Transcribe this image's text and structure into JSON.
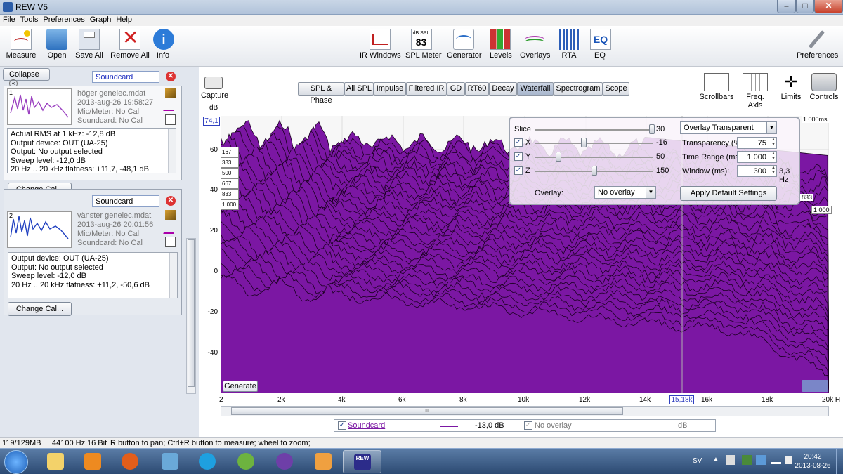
{
  "window": {
    "title": "REW V5"
  },
  "menu": [
    "File",
    "Tools",
    "Preferences",
    "Graph",
    "Help"
  ],
  "toolbar": {
    "left": [
      "Measure",
      "Open",
      "Save All",
      "Remove All",
      "Info"
    ],
    "center": [
      "IR Windows",
      "SPL Meter",
      "Generator",
      "Levels",
      "Overlays",
      "RTA",
      "EQ"
    ],
    "spl_meter_text": "dB SPL",
    "spl_meter_value": "83",
    "eq_text": "EQ",
    "right": "Preferences"
  },
  "left_panel": {
    "collapse_label": "Collapse",
    "measurements": [
      {
        "index": "1",
        "name": "Soundcard",
        "file": "höger genelec.mdat",
        "date": "2013-aug-26 19:58:27",
        "mic": "Mic/Meter: No Cal",
        "soundcard": "Soundcard: No Cal",
        "info": [
          "Actual RMS at 1 kHz: -12,8 dB",
          "Output device: OUT (UA-25)",
          "Output: No output selected",
          "Sweep level: -12,0 dB",
          "20 Hz .. 20 kHz flatness: +11,7, -48,1 dB"
        ],
        "change_cal": "Change Cal...",
        "color": "#9a3fc0"
      },
      {
        "index": "2",
        "name": "Soundcard",
        "file": "vänster genelec.mdat",
        "date": "2013-aug-26 20:01:56",
        "mic": "Mic/Meter: No Cal",
        "soundcard": "Soundcard: No Cal",
        "info": [
          "Output device: OUT (UA-25)",
          "Output: No output selected",
          "Sweep level: -12,0 dB",
          "20 Hz .. 20 kHz flatness: +11,2, -50,6 dB"
        ],
        "change_cal": "Change Cal...",
        "color": "#2040c0"
      }
    ]
  },
  "graph": {
    "capture_label": "Capture",
    "tabs": [
      "SPL & Phase",
      "All SPL",
      "Impulse",
      "Filtered IR",
      "GD",
      "RT60",
      "Decay",
      "Waterfall",
      "Spectrogram",
      "Scope"
    ],
    "active_tab": "Waterfall",
    "right_tools": [
      "Scrollbars",
      "Freq. Axis",
      "Limits",
      "Controls"
    ],
    "y_unit": "dB",
    "y_cursor": "74,1",
    "y_ticks": [
      "60",
      "40",
      "20",
      "0",
      "-20",
      "-40"
    ],
    "x_ticks": [
      "2",
      "2k",
      "4k",
      "6k",
      "8k",
      "10k",
      "12k",
      "14k",
      "16k",
      "18k",
      "20k H"
    ],
    "x_cursor": "15,18k",
    "time_labels": [
      "167",
      "333",
      "500",
      "667",
      "833",
      "1 000"
    ],
    "time_right_labels": [
      "1 000ms",
      "667",
      "833",
      "1 000"
    ],
    "generate_label": "Generate",
    "fill_color": "#7b17a3",
    "scroll_mark": "III"
  },
  "overlay_panel": {
    "slice_label": "Slice",
    "slice_value": "30",
    "x_label": "X",
    "x_value": "-16",
    "y_label": "Y",
    "y_value": "50",
    "z_label": "Z",
    "z_value": "150",
    "overlay_label": "Overlay:",
    "overlay_select": "No overlay",
    "mode_select": "Overlay Transparent",
    "transparency_label": "Transparency (%)",
    "transparency_value": "75",
    "time_range_label": "Time Range (ms):",
    "time_range_value": "1 000",
    "window_label": "Window (ms):",
    "window_value": "300",
    "window_hz": "3,3 Hz",
    "apply_label": "Apply Default Settings"
  },
  "legend": {
    "series_name": "Soundcard",
    "series_value": "-13,0 dB",
    "overlay_name": "No overlay",
    "overlay_unit": "dB"
  },
  "status": {
    "memory": "119/129MB",
    "rate": "44100 Hz",
    "bits": "16 Bit",
    "hint": "R button to pan; Ctrl+R button to measure; wheel to zoom;"
  },
  "taskbar": {
    "lang": "SV",
    "time": "20:42",
    "date": "2013-08-26",
    "rew_label": "REW"
  }
}
